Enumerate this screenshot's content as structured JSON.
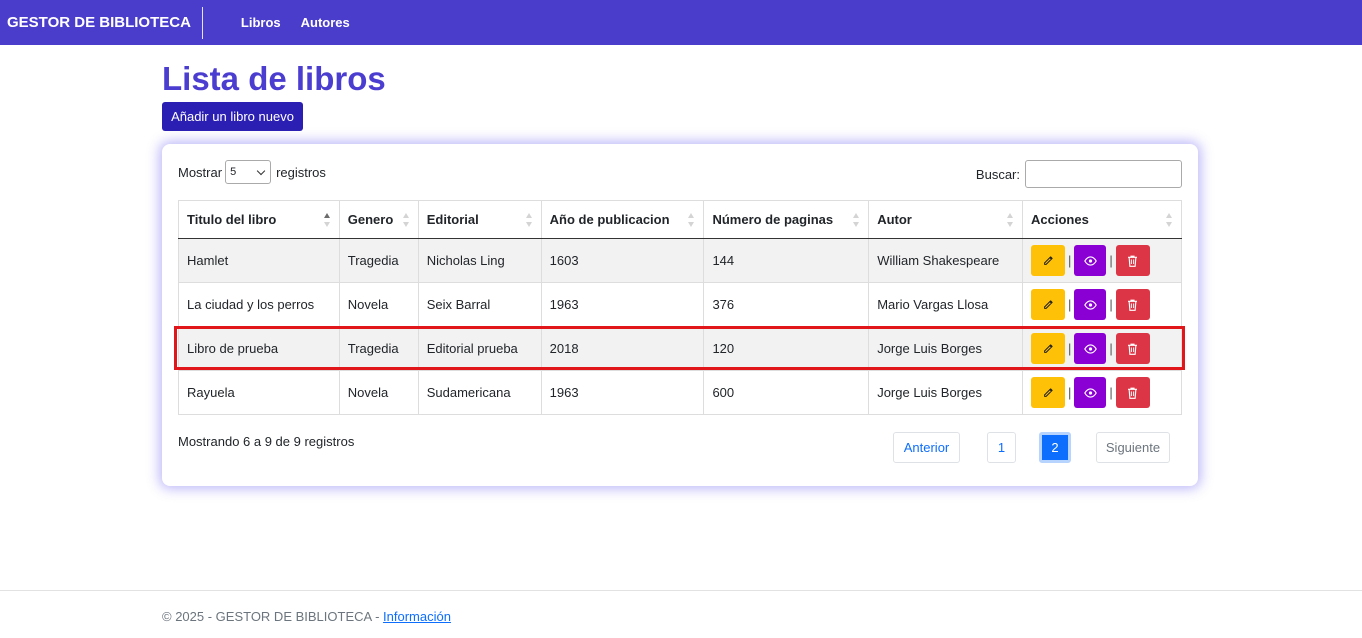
{
  "navbar": {
    "brand": "GESTOR DE BIBLIOTECA",
    "links": [
      "Libros",
      "Autores"
    ],
    "color": "#4b3dcb"
  },
  "page": {
    "title": "Lista de libros",
    "add_button": "Añadir un libro nuevo"
  },
  "table_controls": {
    "show_label": "Mostrar",
    "page_size": "5",
    "records_label": "registros",
    "search_label": "Buscar:",
    "search_value": ""
  },
  "table": {
    "headers": [
      "Titulo del libro",
      "Genero",
      "Editorial",
      "Año de publicacion",
      "Número de paginas",
      "Autor",
      "Acciones"
    ],
    "sorted_column": "Titulo del libro",
    "rows": [
      [
        "Hamlet",
        "Tragedia",
        "Nicholas Ling",
        "1603",
        "144",
        "William Shakespeare"
      ],
      [
        "La ciudad y los perros",
        "Novela",
        "Seix Barral",
        "1963",
        "376",
        "Mario Vargas Llosa"
      ],
      [
        "Libro de prueba",
        "Tragedia",
        "Editorial prueba",
        "2018",
        "120",
        "Jorge Luis Borges"
      ],
      [
        "Rayuela",
        "Novela",
        "Sudamericana",
        "1963",
        "600",
        "Jorge Luis Borges"
      ]
    ],
    "highlighted_row": 2,
    "action_icons": [
      "pencil-icon",
      "eye-icon",
      "trash-icon"
    ]
  },
  "pagination": {
    "info": "Mostrando 6 a 9 de 9 registros",
    "previous": "Anterior",
    "pages": [
      "1",
      "2"
    ],
    "current_page": "2",
    "next": "Siguiente"
  },
  "footer": {
    "text": "© 2025 - GESTOR DE BIBLIOTECA - ",
    "link": "Información"
  },
  "colors": {
    "edit": "#ffc107",
    "view": "#8a00d4",
    "delete": "#dc3545",
    "highlight": "#e0161b",
    "title": "#4b3dd0"
  }
}
